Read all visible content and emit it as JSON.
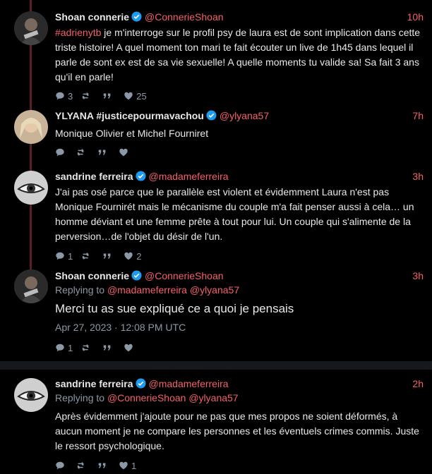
{
  "colors": {
    "accent": "#f4606a",
    "verified": "#1d9bf0",
    "muted": "#8b98a5",
    "thread": "#5a1f24"
  },
  "tweets": [
    {
      "name": "Shoan connerie",
      "handle": "@ConnerieShoan",
      "time": "10h",
      "hashtag": "#adrienytb",
      "text": " je m'interroge sur le profil  psy de laura est de sont implication dans cette triste histoire! A quel moment ton mari te fait écouter un live de 1h45 dans lequel il parle  de sont ex est de sa vie sexuelle!  A quelle moments tu valide sa! Sa fait 3 ans qu'il en parle!",
      "replies": "3",
      "retweets": "",
      "quotes": "",
      "likes": "25"
    },
    {
      "name": "YLYANA #justicepourmavachou",
      "handle": "@ylyana57",
      "time": "7h",
      "text": "Monique Olivier et Michel Fourniret",
      "replies": "",
      "retweets": "",
      "quotes": "",
      "likes": ""
    },
    {
      "name": "sandrine ferreira",
      "handle": "@madameferreira",
      "time": "3h",
      "text": "J'ai pas osé parce que le parallèle est violent et évidemment Laura n'est pas Monique Fournirét mais le mécanisme du couple m'a fait penser aussi à cela… un homme déviant et une femme prête à tout pour lui. Un couple qui s'alimente de la perversion…de l'objet du désir de l'un.",
      "replies": "1",
      "retweets": "",
      "quotes": "",
      "likes": "2"
    },
    {
      "name": "Shoan connerie",
      "handle": "@ConnerieShoan",
      "time": "3h",
      "replying_label": "Replying to",
      "replying_handles": "@madameferreira @ylyana57",
      "text": "Merci tu as sue expliqué ce a quoi je pensais",
      "date": "Apr 27, 2023 · 12:08 PM UTC",
      "replies": "1",
      "retweets": "",
      "quotes": "",
      "likes": ""
    },
    {
      "name": "sandrine ferreira",
      "handle": "@madameferreira",
      "time": "2h",
      "replying_label": "Replying to",
      "replying_handles": "@ConnerieShoan @ylyana57",
      "text": "Après évidemment j'ajoute pour ne pas que mes propos ne soient déformés, à aucun moment je ne compare les personnes et les éventuels crimes commis. Juste le ressort psychologique.",
      "replies": "",
      "retweets": "",
      "quotes": "",
      "likes": "1"
    }
  ]
}
